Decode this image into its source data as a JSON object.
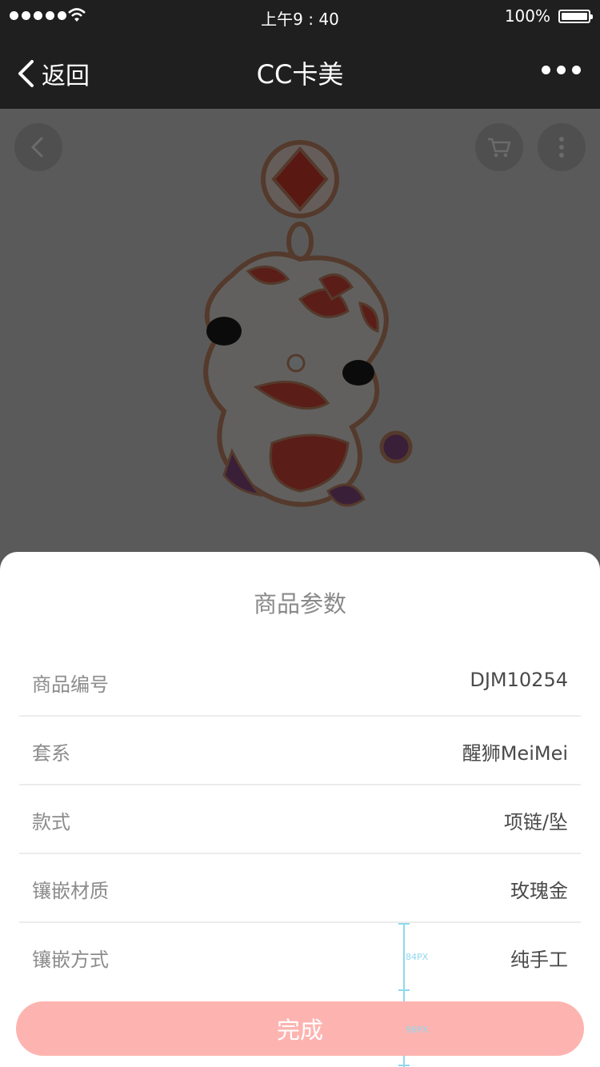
{
  "status_bar": {
    "time": "上午9 : 40",
    "battery": "100%"
  },
  "navbar": {
    "back_label": "返回",
    "title": "CC卡美"
  },
  "sheet": {
    "title": "商品参数",
    "params": [
      {
        "label": "商品编号",
        "value": "DJM10254"
      },
      {
        "label": "套系",
        "value": "醒狮MeiMei"
      },
      {
        "label": "款式",
        "value": "项链/坠"
      },
      {
        "label": "镶嵌材质",
        "value": "玫瑰金"
      },
      {
        "label": "镶嵌方式",
        "value": "纯手工"
      }
    ],
    "done_label": "完成"
  },
  "annotations": {
    "row_height": "84PX",
    "button_area": "96PX"
  },
  "colors": {
    "accent": "#fdb4b0",
    "bar_background": "#1f1f1f"
  }
}
